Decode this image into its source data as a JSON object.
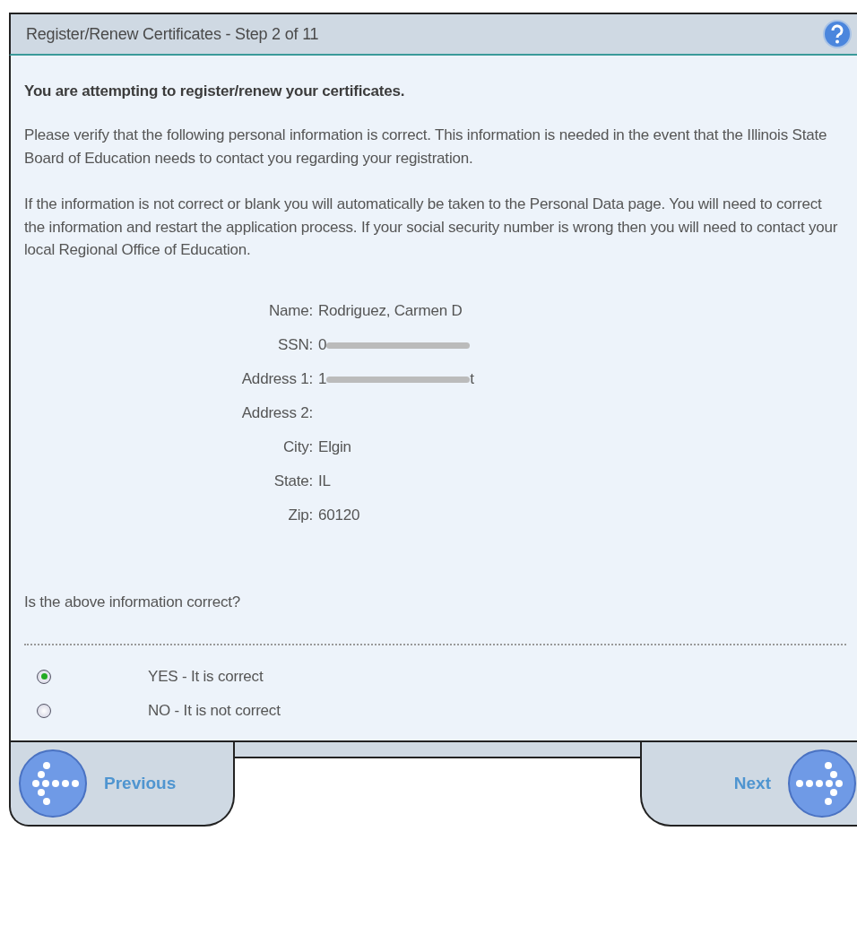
{
  "window": {
    "title": "Register/Renew Certificates - Step 2 of 11"
  },
  "intro": "You are attempting to register/renew your certificates.",
  "paragraphs": [
    "Please verify that the following personal information is correct. This information is needed in the event that the Illinois State Board of Education needs to contact you regarding your registration.",
    "If the information is not correct or blank you will automatically be taken to the Personal Data page. You will need to correct the information and restart the application process. If your social security number is wrong then you will need to contact your local Regional Office of Education."
  ],
  "details": [
    {
      "label": "Name:",
      "value": "Rodriguez, Carmen D",
      "redacted": false
    },
    {
      "label": "SSN:",
      "value": "0",
      "redacted": true
    },
    {
      "label": "Address 1:",
      "value": "1",
      "redacted": true,
      "value_end": "t"
    },
    {
      "label": "Address 2:",
      "redacted": false
    },
    {
      "label": "City:",
      "value": "Elgin",
      "redacted": false
    },
    {
      "label": "State:",
      "value": "IL",
      "redacted": false
    },
    {
      "label": "Zip:",
      "value": "60120",
      "redacted": false
    }
  ],
  "question": "Is the above information correct?",
  "options": [
    {
      "label": "YES - It is correct",
      "selected": true
    },
    {
      "label": "NO - It is not correct",
      "selected": false
    }
  ],
  "nav": {
    "previous": "Previous",
    "next": "Next"
  }
}
